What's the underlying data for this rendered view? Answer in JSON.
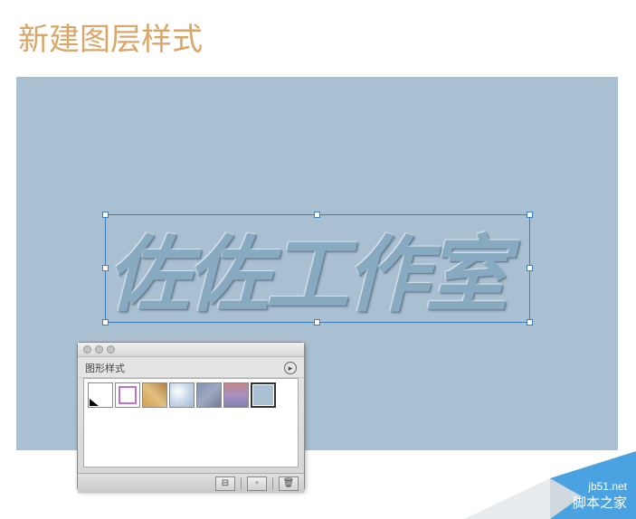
{
  "title": "新建图层样式",
  "canvas": {
    "text": "佐佐工作室"
  },
  "panel": {
    "tab_label": "图形样式",
    "swatches": [
      {
        "name": "none"
      },
      {
        "name": "outline"
      },
      {
        "name": "texture-gold"
      },
      {
        "name": "sphere"
      },
      {
        "name": "texture-blue"
      },
      {
        "name": "texture-purple"
      },
      {
        "name": "current-selected"
      }
    ]
  },
  "watermark": {
    "url": "jb51.net",
    "name": "脚本之家"
  }
}
